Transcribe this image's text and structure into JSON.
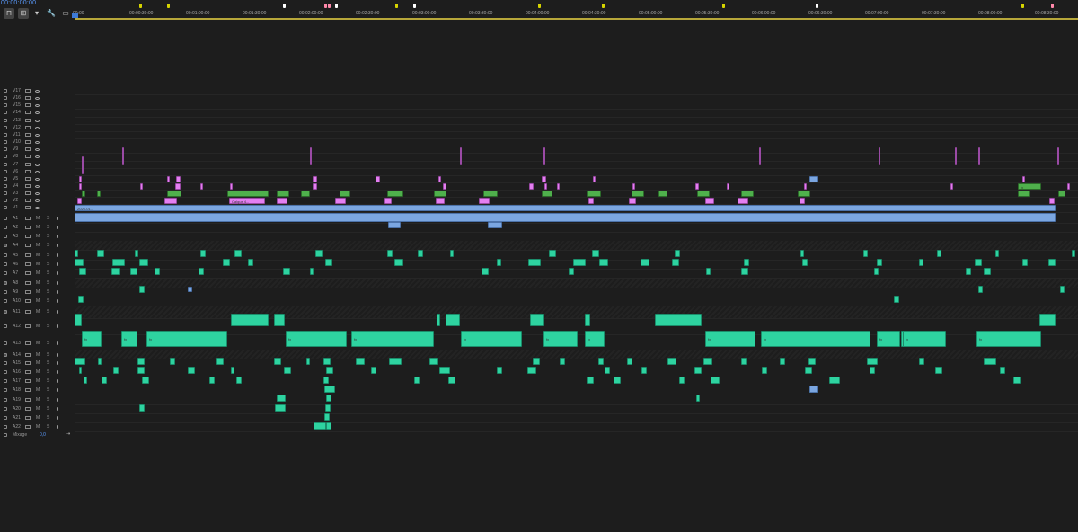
{
  "sequence": {
    "timecode": "00:00:00:00",
    "tools": [
      {
        "icon": "snap-icon",
        "label": "⊓"
      },
      {
        "icon": "linked-selection-icon",
        "label": "⊞"
      },
      {
        "icon": "add-marker-icon",
        "label": "▾"
      },
      {
        "icon": "wrench-icon",
        "label": "🔧"
      },
      {
        "icon": "captions-icon",
        "label": "▭"
      }
    ]
  },
  "ruler": {
    "ticks": [
      "00:00",
      "00:00:30:00",
      "00:01:00:00",
      "00:01:30:00",
      "00:02:00:00",
      "00:02:30:00",
      "00:03:00:00",
      "00:03:30:00",
      "00:04:00:00",
      "00:04:30:00",
      "00:05:00:00",
      "00:05:30:00",
      "00:06:00:00",
      "00:06:30:00",
      "00:07:00:00",
      "00:07:30:00",
      "00:08:00:00",
      "00:08:30:00"
    ],
    "marker_colors": [
      "#ffffff",
      "#d6d400",
      "#ff88aa",
      "#ffcc66"
    ]
  },
  "video_tracks": [
    "V17",
    "V16",
    "V15",
    "V14",
    "V13",
    "V12",
    "V11",
    "V10",
    "V9",
    "V8",
    "V7",
    "V6",
    "V5",
    "V4",
    "V3",
    "V2",
    "V1"
  ],
  "audio_tracks": [
    "A1",
    "A2",
    "A3",
    "A4",
    "A5",
    "A6",
    "A7",
    "A8",
    "A9",
    "A10",
    "A11",
    "A12",
    "A13",
    "A14",
    "A15",
    "A16",
    "A17",
    "A18",
    "A19",
    "A20",
    "A21",
    "A22"
  ],
  "track_buttons": {
    "mute": "M",
    "solo": "S"
  },
  "clip_labels": [
    "Calque 4...",
    "fx",
    "2026-01...",
    "Ca...",
    "Cl..."
  ],
  "mix": {
    "label": "Mixage",
    "value": "0,0"
  },
  "colors": {
    "audio_clip": "#2ed3a0",
    "video_clip_green": "#4fb04c",
    "video_clip_pink": "#e47ff0",
    "video_clip_blue": "#7ba6e0",
    "playhead": "#3d7ad6",
    "work_area": "#b7a73a"
  }
}
